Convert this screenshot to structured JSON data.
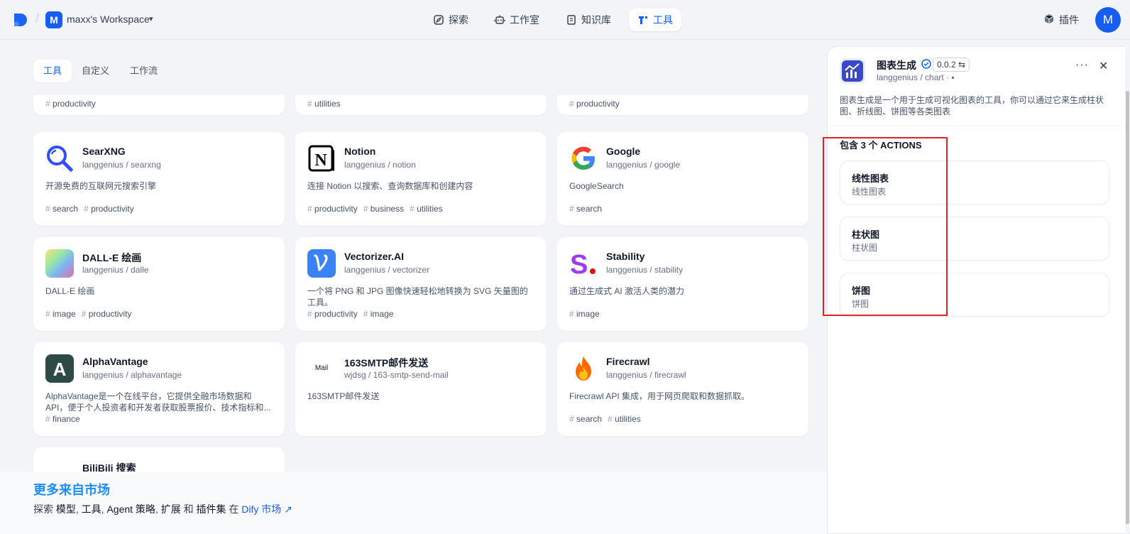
{
  "workspace": {
    "avatar": "M",
    "name": "maxx's Workspace"
  },
  "nav": [
    {
      "label": "探索",
      "icon": "compass-icon"
    },
    {
      "label": "工作室",
      "icon": "robot-icon"
    },
    {
      "label": "知识库",
      "icon": "book-icon"
    },
    {
      "label": "工具",
      "icon": "tool-icon",
      "active": true
    }
  ],
  "plugins_label": "插件",
  "user_avatar": "M",
  "subtabs": [
    "工具",
    "自定义",
    "工作流"
  ],
  "partial_tags": [
    [
      "productivity"
    ],
    [
      "utilities"
    ],
    [
      "productivity"
    ]
  ],
  "cards": [
    {
      "name": "SearXNG",
      "org": "langgenius / searxng",
      "desc": "开源免费的互联网元搜索引擎",
      "tags": [
        "search",
        "productivity"
      ],
      "icon": "searxng-icon"
    },
    {
      "name": "Notion",
      "org": "langgenius / notion",
      "desc": "连接 Notion 以搜索、查询数据库和创建内容",
      "tags": [
        "productivity",
        "business",
        "utilities"
      ],
      "icon": "notion-icon"
    },
    {
      "name": "Google",
      "org": "langgenius / google",
      "desc": "GoogleSearch",
      "tags": [
        "search"
      ],
      "icon": "google-icon"
    },
    {
      "name": "DALL-E 绘画",
      "org": "langgenius / dalle",
      "desc": "DALL-E 绘画",
      "tags": [
        "image",
        "productivity"
      ],
      "icon": "dalle-icon"
    },
    {
      "name": "Vectorizer.AI",
      "org": "langgenius / vectorizer",
      "desc": "一个将 PNG 和 JPG 图像快速轻松地转换为 SVG 矢量图的工具。",
      "tags": [
        "productivity",
        "image"
      ],
      "icon": "vectorizer-icon"
    },
    {
      "name": "Stability",
      "org": "langgenius / stability",
      "desc": "通过生成式 AI 激活人类的潜力",
      "tags": [
        "image"
      ],
      "icon": "stability-icon"
    },
    {
      "name": "AlphaVantage",
      "org": "langgenius / alphavantage",
      "desc": "AlphaVantage是一个在线平台，它提供全融市场数据和API，便于个人投资者和开发者获取股票报价、技术指标和...",
      "tags": [
        "finance"
      ],
      "icon": "alphavantage-icon"
    },
    {
      "name": "163SMTP邮件发送",
      "org": "wjdsg / 163-smtp-send-mail",
      "desc": "163SMTP邮件发送",
      "tags": [],
      "icon": "mail-icon",
      "icon_text": "Mail"
    },
    {
      "name": "Firecrawl",
      "org": "langgenius / firecrawl",
      "desc": "Firecrawl API 集成，用于网页爬取和数据抓取。",
      "tags": [
        "search",
        "utilities"
      ],
      "icon": "firecrawl-icon"
    },
    {
      "name": "BiliBili 搜索",
      "org": "",
      "desc": "",
      "tags": [],
      "icon": "bilibili-icon"
    }
  ],
  "market": {
    "title": "更多来自市场",
    "prefix": "探索",
    "models": "模型",
    "tools": "工具",
    "strategies": "Agent 策略",
    "ext": "扩展",
    "and": "和",
    "bundles": "插件集",
    "in": "在",
    "link": "Dify 市场"
  },
  "panel": {
    "title": "图表生成",
    "version": "0.0.2",
    "org": "langgenius / chart ·",
    "desc": "图表生成是一个用于生成可视化图表的工具，你可以通过它来生成柱状图、折线图、饼图等各类图表",
    "actions_title": "包含 3 个 ACTIONS",
    "actions": [
      {
        "name": "线性图表",
        "desc": "线性图表"
      },
      {
        "name": "柱状图",
        "desc": "柱状图"
      },
      {
        "name": "饼图",
        "desc": "饼图"
      }
    ]
  },
  "colors": {
    "accent": "#155eef",
    "market_title": "#1d8cf8",
    "highlight": "#e02424"
  }
}
